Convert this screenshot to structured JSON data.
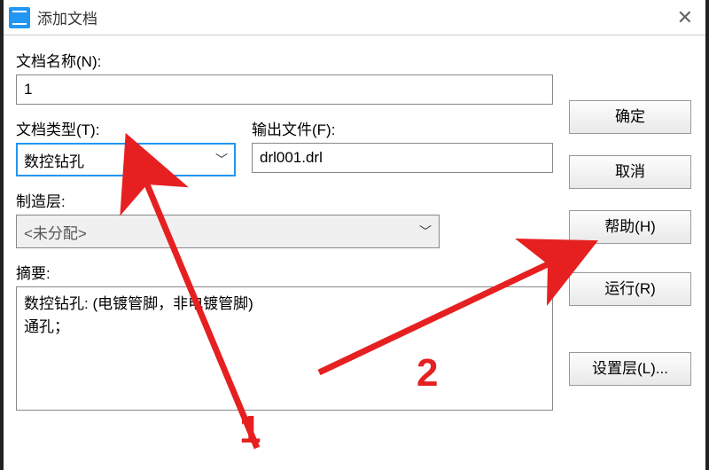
{
  "window": {
    "title": "添加文档"
  },
  "labels": {
    "docName": "文档名称(N):",
    "docType": "文档类型(T):",
    "outputFile": "输出文件(F):",
    "mfgLayer": "制造层:",
    "summary": "摘要:"
  },
  "fields": {
    "docName": "1",
    "docType": "数控钻孔",
    "outputFile": "drl001.drl",
    "mfgLayer": "<未分配>",
    "summary": "数控钻孔: (电镀管脚，非电镀管脚)\n通孔；"
  },
  "buttons": {
    "ok": "确定",
    "cancel": "取消",
    "help": "帮助(H)",
    "run": "运行(R)",
    "setLayer": "设置层(L)..."
  },
  "annotations": {
    "n1": "1",
    "n2": "2"
  }
}
